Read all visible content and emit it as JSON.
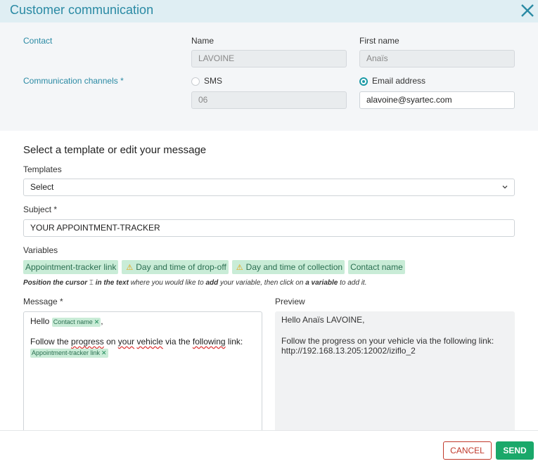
{
  "header": {
    "title": "Customer communication"
  },
  "contact": {
    "label": "Contact",
    "name_label": "Name",
    "name_value": "LAVOINE",
    "first_name_label": "First name",
    "first_name_value": "Anaïs"
  },
  "channels": {
    "label": "Communication channels *",
    "sms_label": "SMS",
    "sms_value": "06",
    "sms_selected": false,
    "email_label": "Email address",
    "email_value": "alavoine@syartec.com",
    "email_selected": true
  },
  "template_section": {
    "title": "Select a template or edit your message",
    "templates_label": "Templates",
    "templates_value": "Select",
    "subject_label": "Subject *",
    "subject_value": "YOUR APPOINTMENT-TRACKER"
  },
  "variables": {
    "label": "Variables",
    "chips": [
      {
        "label": "Appointment-tracker link",
        "warning": false
      },
      {
        "label": "Day and time of drop-off",
        "warning": true
      },
      {
        "label": "Day and time of collection",
        "warning": true
      },
      {
        "label": "Contact name",
        "warning": false
      }
    ],
    "hint": {
      "p1": "Position the cursor",
      "p2": "in the text",
      "p3": "where you would like to",
      "p4": "add",
      "p5": "your variable, then click on",
      "p6": "a variable",
      "p7": "to add it."
    }
  },
  "message": {
    "label": "Message *",
    "line1_prefix": "Hello",
    "line1_chip": "Contact name",
    "line1_suffix": ",",
    "line2_a": "Follow the",
    "line2_b": "progress",
    "line2_c": "on",
    "line2_d": "your",
    "line2_e": "vehicle",
    "line2_f": "via the",
    "line2_g": "following",
    "line2_h": "link:",
    "line3_chip": "Appointment-tracker link"
  },
  "preview": {
    "label": "Preview",
    "line1": "Hello Anaïs LAVOINE,",
    "line2": "Follow the progress on your vehicle via the following link:",
    "line3": "http://192.168.13.205:12002/iziflo_2"
  },
  "footer": {
    "cancel_label": "CANCEL",
    "send_label": "SEND"
  },
  "colors": {
    "accent": "#2a8aa4",
    "send": "#1aa86a",
    "cancel": "#c0392b",
    "chip_bg": "#c9ecd7"
  },
  "icons": {
    "close": "close-icon",
    "chevron": "chevron-down-icon",
    "warning": "warning-icon",
    "cursor": "text-cursor-icon",
    "remove": "remove-icon"
  }
}
